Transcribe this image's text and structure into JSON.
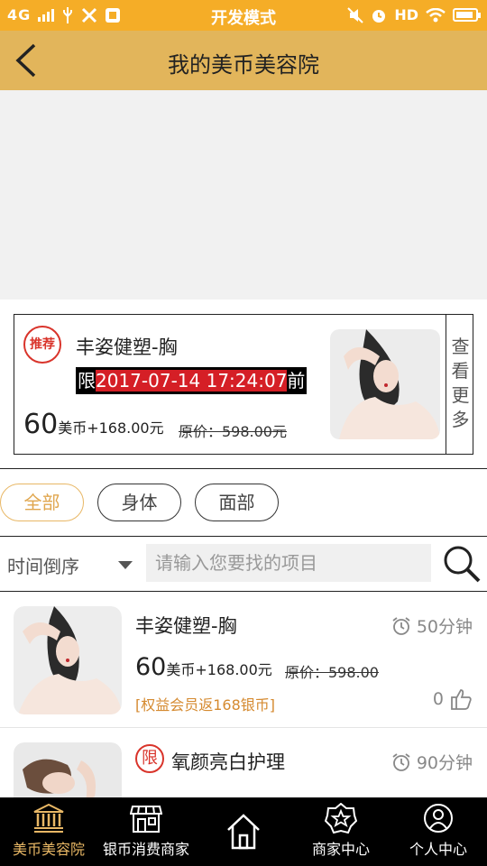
{
  "status_bar": {
    "network": "4G",
    "mode_text": "开发模式",
    "hd": "HD",
    "icons": [
      "signal-icon",
      "usb-icon",
      "tools-icon",
      "app-icon",
      "mute-icon",
      "alarm-icon",
      "wifi-icon",
      "battery-icon"
    ],
    "background_color": "#f5ad27"
  },
  "header": {
    "title": "我的美币美容院",
    "back_icon": "back-arrow-icon",
    "background_color": "#e2b55b"
  },
  "recommended": {
    "badge": "推荐",
    "name": "丰姿健塑-胸",
    "limit_prefix": "限",
    "limit_datetime": "2017-07-14 17:24:07",
    "limit_suffix": "前",
    "price_coins": "60",
    "price_unit": "美币",
    "price_cash": "+168.00元",
    "original_price": "原价：598.00元",
    "more_label": [
      "查",
      "看",
      "更",
      "多"
    ]
  },
  "tabs": [
    {
      "label": "全部",
      "active": true
    },
    {
      "label": "身体",
      "active": false
    },
    {
      "label": "面部",
      "active": false
    }
  ],
  "filter": {
    "sort_label": "时间倒序",
    "search_placeholder": "请输入您要找的项目",
    "search_icon": "search-icon"
  },
  "items": [
    {
      "name": "丰姿健塑-胸",
      "duration": "50分钟",
      "price_coins": "60",
      "price_unit": "美币",
      "price_cash": "+168.00元",
      "original_price": "原价：598.00",
      "tag": "[权益会员返168银币]",
      "likes": "0"
    },
    {
      "limit_badge": "限",
      "name": "氧颜亮白护理",
      "duration": "90分钟"
    }
  ],
  "bottom_nav": [
    {
      "label": "美币美容院",
      "icon": "bank-icon",
      "active": true
    },
    {
      "label": "银币消费商家",
      "icon": "storefront-icon",
      "active": false
    },
    {
      "label": "",
      "icon": "home-icon",
      "active": false
    },
    {
      "label": "商家中心",
      "icon": "star-badge-icon",
      "active": false
    },
    {
      "label": "个人中心",
      "icon": "user-icon",
      "active": false
    }
  ],
  "colors": {
    "accent": "#e0a64e",
    "limit_red": "#d51f26",
    "tag_orange": "#d58a30"
  }
}
